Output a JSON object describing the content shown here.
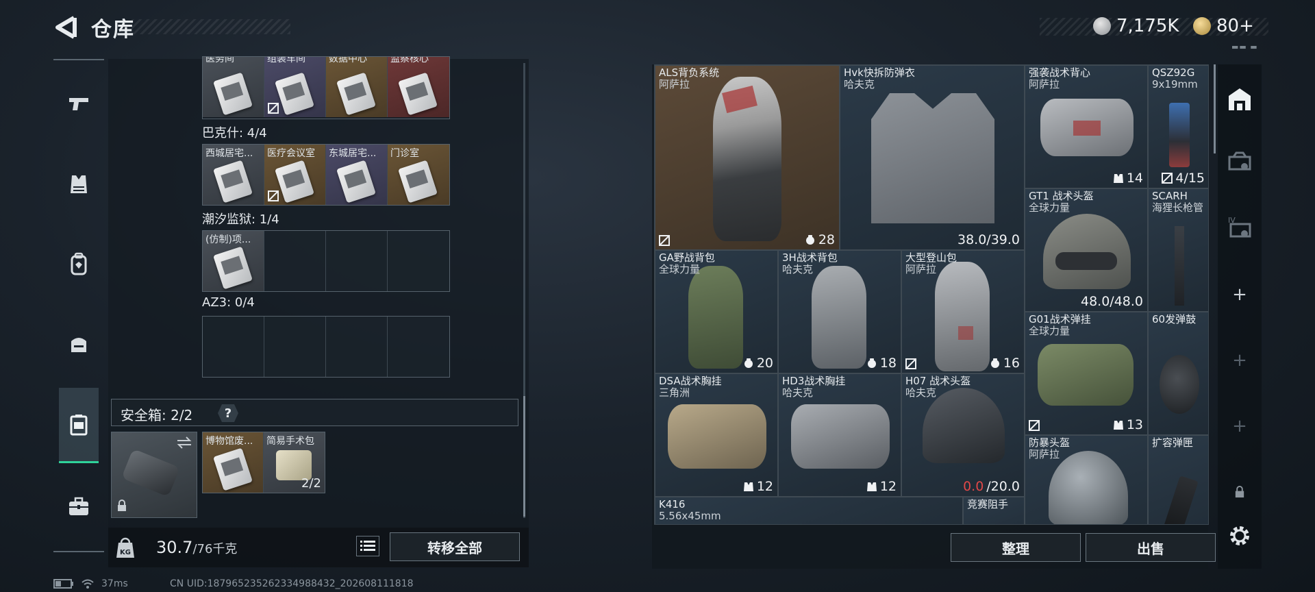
{
  "header": {
    "title": "仓库",
    "currency_silver": "7,175K",
    "currency_gold": "80+"
  },
  "left_rail": {
    "items": [
      {
        "name": "weapons",
        "icon": "pistol-icon"
      },
      {
        "name": "armor",
        "icon": "vest-icon"
      },
      {
        "name": "backpack",
        "icon": "backpack-icon"
      },
      {
        "name": "chest-rig",
        "icon": "rig-icon"
      },
      {
        "name": "keys",
        "icon": "keycase-icon"
      },
      {
        "name": "medkit",
        "icon": "briefcase-icon"
      }
    ],
    "active": "keys"
  },
  "key_groups": [
    {
      "label": "",
      "cells": [
        {
          "name": "医务间",
          "color": "gray",
          "no_drop": false
        },
        {
          "name": "组装车间",
          "color": "purple",
          "no_drop": true
        },
        {
          "name": "数据中心",
          "color": "brown",
          "no_drop": false
        },
        {
          "name": "监察核心",
          "color": "red",
          "no_drop": false
        }
      ]
    },
    {
      "label": "巴克什: 4/4",
      "cells": [
        {
          "name": "西城居宅...",
          "color": "gray",
          "no_drop": false
        },
        {
          "name": "医疗会议室",
          "color": "brown",
          "no_drop": true
        },
        {
          "name": "东城居宅...",
          "color": "purple",
          "no_drop": false
        },
        {
          "name": "门诊室",
          "color": "brown",
          "no_drop": false
        }
      ]
    },
    {
      "label": "潮汐监狱: 1/4",
      "cells": [
        {
          "name": "(仿制)项...",
          "color": "gray",
          "no_drop": false
        },
        {
          "name": "",
          "color": "empty",
          "no_drop": false
        },
        {
          "name": "",
          "color": "empty",
          "no_drop": false
        },
        {
          "name": "",
          "color": "empty",
          "no_drop": false
        }
      ]
    },
    {
      "label": "AZ3: 0/4",
      "cells": [
        {
          "name": "",
          "color": "empty",
          "no_drop": false
        },
        {
          "name": "",
          "color": "empty",
          "no_drop": false
        },
        {
          "name": "",
          "color": "empty",
          "no_drop": false
        },
        {
          "name": "",
          "color": "empty",
          "no_drop": false
        }
      ]
    }
  ],
  "safe": {
    "title": "安全箱: 2/2",
    "help": "?",
    "items": [
      {
        "name": "博物馆废...",
        "qty": ""
      },
      {
        "name": "简易手术包",
        "qty": "2/2"
      }
    ]
  },
  "bottom": {
    "weight_current": "30.7",
    "weight_max": "/76千克",
    "weight_icon_label": "KG",
    "transfer_label": "转移全部"
  },
  "status": {
    "ping": "37ms",
    "uid": "CN UID:1879652352623349884​32_202608111818"
  },
  "inventory": [
    {
      "id": "als",
      "name": "ALS背负系统",
      "sub": "阿萨拉",
      "qty": "28",
      "qty_icon": "capacity",
      "left_icon": "no-drop",
      "left_text": "",
      "bg": "tan"
    },
    {
      "id": "hvk",
      "name": "Hvk快拆防弹衣",
      "sub": "哈夫克",
      "qty": "38.0/39.0",
      "qty_icon": "",
      "left_icon": "",
      "left_text": "",
      "bg": "blue"
    },
    {
      "id": "raid",
      "name": "强袭战术背心",
      "sub": "阿萨拉",
      "qty": "14",
      "qty_icon": "rig",
      "left_icon": "",
      "left_text": "",
      "bg": "blue"
    },
    {
      "id": "qsz",
      "name": "QSZ92G",
      "sub": "9x19mm",
      "qty": "4/15",
      "qty_icon": "no-drop",
      "left_icon": "",
      "left_text": "",
      "bg": "blue"
    },
    {
      "id": "gt1",
      "name": "GT1 战术头盔",
      "sub": "全球力量",
      "qty": "48.0/48.0",
      "qty_icon": "",
      "left_icon": "",
      "left_text": "",
      "bg": "blue"
    },
    {
      "id": "scarh",
      "name": "SCARH",
      "sub": "海狸长枪管",
      "qty": "",
      "qty_icon": "",
      "left_icon": "",
      "left_text": "",
      "bg": "blue"
    },
    {
      "id": "ga",
      "name": "GA野战背包",
      "sub": "全球力量",
      "qty": "20",
      "qty_icon": "capacity",
      "left_icon": "",
      "left_text": "",
      "bg": "blue"
    },
    {
      "id": "3h",
      "name": "3H战术背包",
      "sub": "哈夫克",
      "qty": "18",
      "qty_icon": "capacity",
      "left_icon": "",
      "left_text": "",
      "bg": "blue"
    },
    {
      "id": "mount",
      "name": "大型登山包",
      "sub": "阿萨拉",
      "qty": "16",
      "qty_icon": "capacity",
      "left_icon": "no-drop",
      "left_text": "",
      "bg": "blue"
    },
    {
      "id": "g01",
      "name": "G01战术弹挂",
      "sub": "全球力量",
      "qty": "13",
      "qty_icon": "rig",
      "left_icon": "no-drop",
      "left_text": "",
      "bg": "blue"
    },
    {
      "id": "drum",
      "name": "60发弹鼓",
      "sub": "",
      "qty": "",
      "qty_icon": "",
      "left_icon": "",
      "left_text": "",
      "bg": "blue"
    },
    {
      "id": "dsa",
      "name": "DSA战术胸挂",
      "sub": "三角洲",
      "qty": "12",
      "qty_icon": "rig",
      "left_icon": "",
      "left_text": "",
      "bg": "blue"
    },
    {
      "id": "hd3",
      "name": "HD3战术胸挂",
      "sub": "哈夫克",
      "qty": "12",
      "qty_icon": "rig",
      "left_icon": "",
      "left_text": "",
      "bg": "blue"
    },
    {
      "id": "h07",
      "name": "H07 战术头盔",
      "sub": "哈夫克",
      "qty": "/20.0",
      "qty_red": "0.0",
      "qty_icon": "",
      "left_icon": "",
      "left_text": "",
      "bg": "blue"
    },
    {
      "id": "riot",
      "name": "防暴头盔",
      "sub": "阿萨拉",
      "qty": "",
      "qty_icon": "",
      "left_icon": "",
      "left_text": "",
      "bg": "blue"
    },
    {
      "id": "ext",
      "name": "扩容弹匣",
      "sub": "",
      "qty": "",
      "qty_icon": "",
      "left_icon": "",
      "left_text": "",
      "bg": "blue"
    },
    {
      "id": "k416",
      "name": "K416",
      "sub": "5.56x45mm",
      "qty": "",
      "qty_icon": "",
      "left_icon": "",
      "left_text": "",
      "bg": "blue"
    },
    {
      "id": "comp",
      "name": "竞赛阻手",
      "sub": "",
      "qty": "",
      "qty_icon": "",
      "left_icon": "",
      "left_text": "",
      "bg": "blue"
    }
  ],
  "actions": {
    "sort_label": "整理",
    "sell_label": "出售"
  },
  "colors": {
    "accent_green": "#2fd39a",
    "durability_red": "#e04848",
    "tan_rarity": "#5c4a38",
    "blue_rarity": "#2b3a48"
  }
}
